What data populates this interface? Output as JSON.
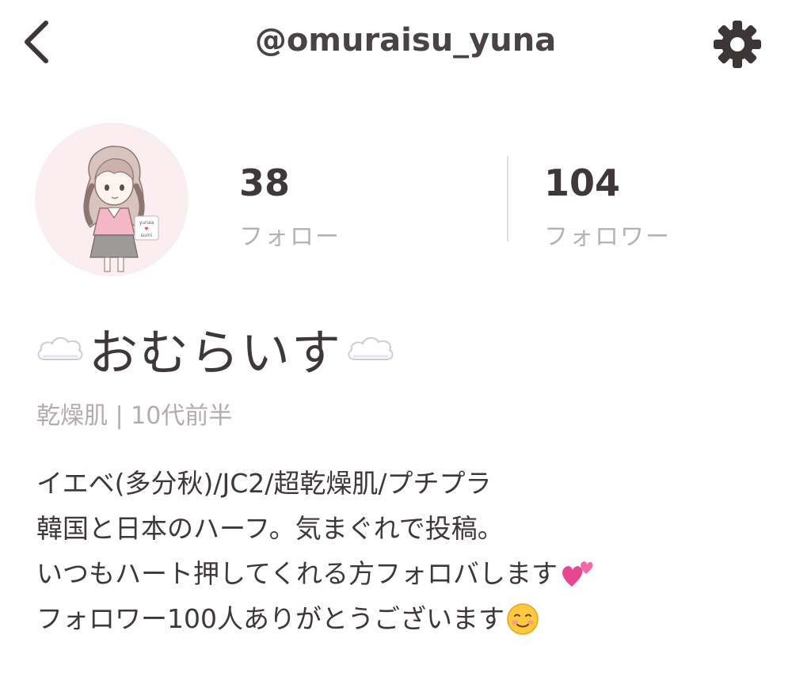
{
  "header": {
    "username": "@omuraisu_yuna"
  },
  "stats": {
    "follow_count": "38",
    "follow_label": "フォロー",
    "followers_count": "104",
    "followers_label": "フォロワー"
  },
  "profile": {
    "display_name": "おむらいす",
    "meta": "乾燥肌 | 10代前半",
    "bio": [
      "イエベ(多分秋)/JC2/超乾燥肌/プチプラ",
      "韓国と日本のハーフ。気まぐれで投稿。",
      "いつもハート押してくれる方フォロバします",
      "フォロワー100人ありがとうございます"
    ],
    "avatar_badge_text": "yunaa\n♥\nsumi"
  },
  "icons": {
    "back": "chevron-left-icon",
    "settings": "gear-icon",
    "name_decoration": "cloud-icon",
    "bio_line3_emoji": "two-hearts-emoji",
    "bio_line4_emoji": "smiling-face-emoji"
  },
  "colors": {
    "text_primary": "#3f3838",
    "text_muted": "#b4acac",
    "avatar_bg": "#fbeef1",
    "heart_pink": "#e8468f",
    "divider": "#e3dede"
  }
}
